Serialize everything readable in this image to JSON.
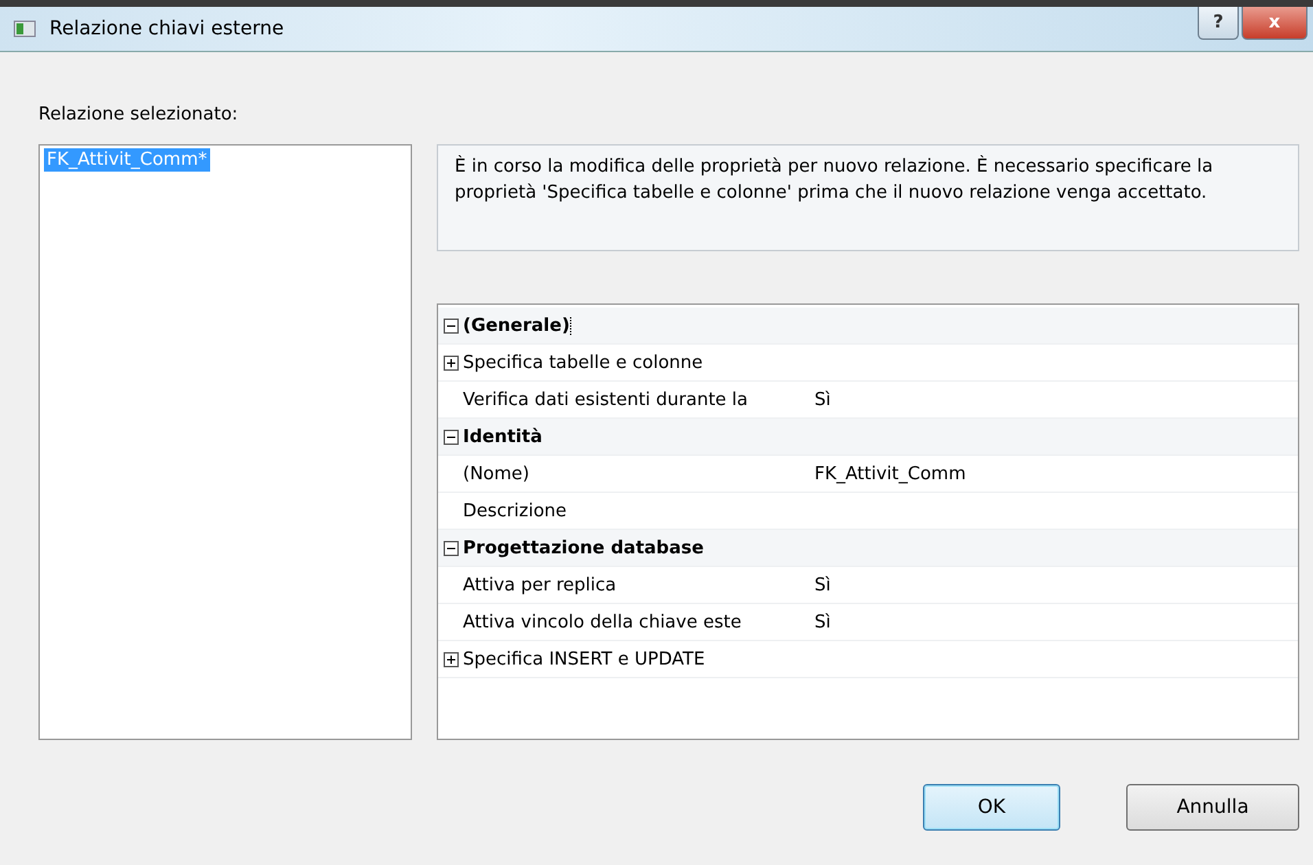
{
  "window": {
    "title": "Relazione chiavi esterne",
    "buttons": [
      "?",
      "x"
    ]
  },
  "list_label": "Relazione selezionato:",
  "relations": [
    {
      "name": "FK_Attivit_Comm*",
      "selected": true
    }
  ],
  "description": "È in corso la modifica delle proprietà per nuovo relazione.  È necessario specificare la proprietà 'Specifica tabelle e colonne' prima che il nuovo relazione venga accettato.",
  "properties": [
    {
      "category": "(Generale)",
      "expanded": true,
      "focused": true,
      "rows": [
        {
          "kind": "group",
          "name": "Specifica tabelle e colonne",
          "expanded": false
        },
        {
          "kind": "property",
          "name": "Verifica dati esistenti durante la",
          "value": "Sì"
        }
      ]
    },
    {
      "category": "Identità",
      "expanded": true,
      "focused": false,
      "rows": [
        {
          "kind": "property",
          "name": "(Nome)",
          "value": "FK_Attivit_Comm"
        },
        {
          "kind": "property",
          "name": "Descrizione"
        }
      ]
    },
    {
      "category": "Progettazione database",
      "expanded": true,
      "focused": false,
      "rows": [
        {
          "kind": "property",
          "name": "Attiva per replica",
          "value": "Sì"
        },
        {
          "kind": "property",
          "name": "Attiva vincolo della chiave este",
          "value": "Sì"
        },
        {
          "kind": "group",
          "name": "Specifica INSERT e UPDATE",
          "expanded": false
        }
      ]
    }
  ],
  "buttons": [
    {
      "label": "OK",
      "default": true
    },
    {
      "label": "Annulla",
      "default": false
    }
  ]
}
